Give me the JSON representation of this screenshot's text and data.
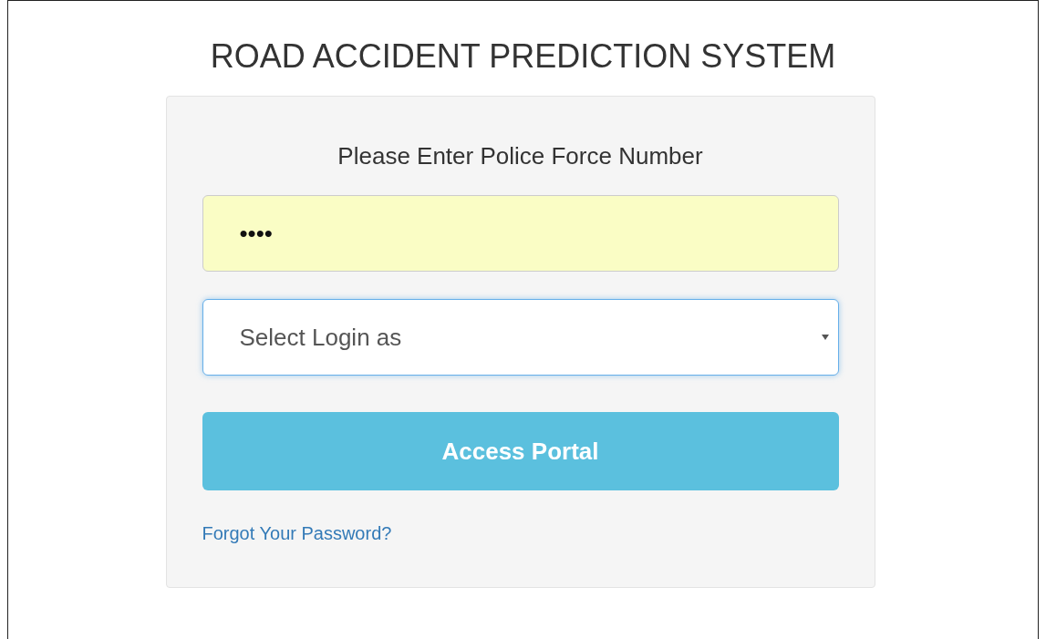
{
  "title": "ROAD ACCIDENT PREDICTION SYSTEM",
  "login_form": {
    "label": "Please Enter Police Force Number",
    "password": {
      "value": "••••",
      "autofilled": true
    },
    "select": {
      "placeholder": "Select Login as",
      "focused": true
    },
    "button": "Access Portal",
    "link": "Forgot Your Password?"
  }
}
